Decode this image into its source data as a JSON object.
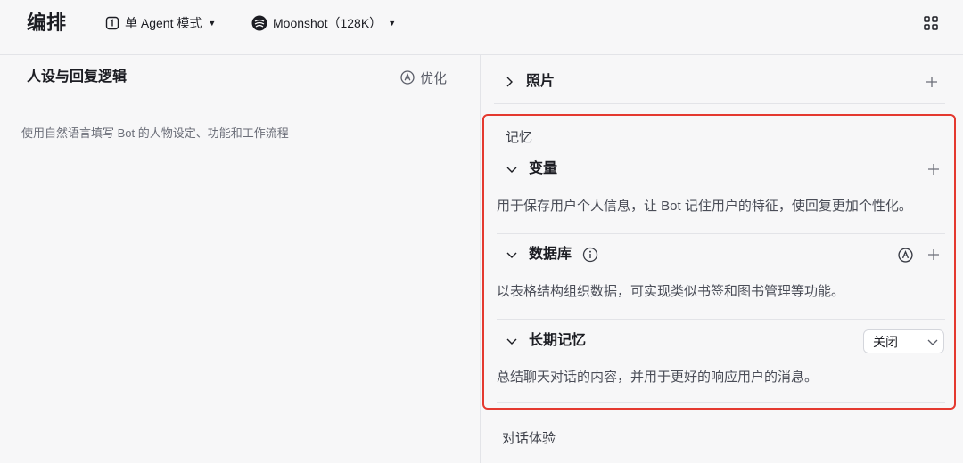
{
  "header": {
    "title": "编排",
    "mode_label": "单 Agent 模式",
    "model_label": "Moonshot（128K）"
  },
  "left": {
    "section_title": "人设与回复逻辑",
    "optimize_label": "优化",
    "placeholder": "使用自然语言填写 Bot 的人物设定、功能和工作流程"
  },
  "right": {
    "photo_label": "照片",
    "memory": {
      "title": "记忆",
      "variables": {
        "label": "变量",
        "desc": "用于保存用户个人信息，让 Bot 记住用户的特征，使回复更加个性化。"
      },
      "database": {
        "label": "数据库",
        "desc": "以表格结构组织数据，可实现类似书签和图书管理等功能。"
      },
      "long_term": {
        "label": "长期记忆",
        "select_value": "关闭",
        "desc": "总结聊天对话的内容，并用于更好的响应用户的消息。"
      }
    },
    "dialog_title": "对话体验"
  },
  "colors": {
    "highlight_border": "#e4392f",
    "divider": "#e3e4e8",
    "background": "#f7f7f8"
  },
  "icons": [
    "agent-mode-icon",
    "model-logo-icon",
    "caret-down-icon",
    "grid-icon",
    "ai-optimize-icon",
    "chevron-right-icon",
    "chevron-down-icon",
    "plus-icon",
    "info-icon"
  ]
}
